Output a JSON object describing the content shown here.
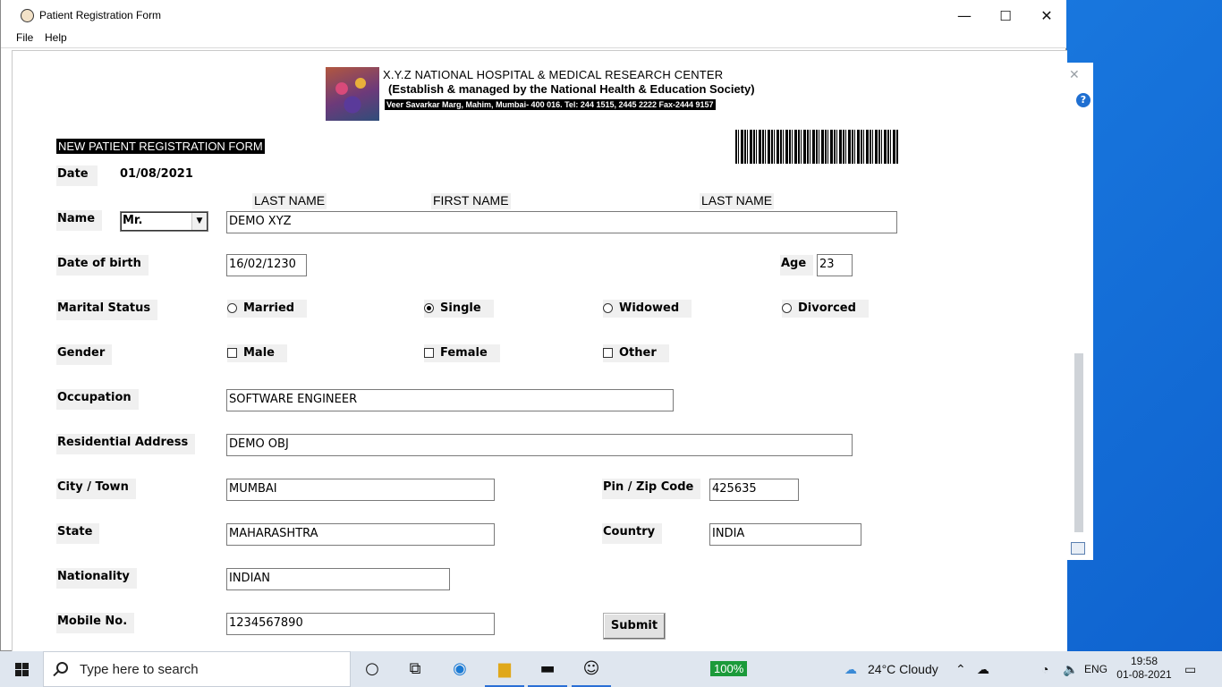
{
  "window": {
    "title": "Patient Registration Form",
    "controls": {
      "minimize": "—",
      "maximize": "☐",
      "close": "✕"
    }
  },
  "menu": [
    "File",
    "Help"
  ],
  "header": {
    "line1": "X.Y.Z NATIONAL HOSPITAL & MEDICAL RESEARCH CENTER",
    "line2": "(Establish & managed by the National Health & Education Society)",
    "line3": "Veer Savarkar Marg, Mahim, Mumbai- 400 016.  Tel: 244 1515, 2445 2222 Fax-2444 9157"
  },
  "form": {
    "title": "NEW PATIENT REGISTRATION FORM",
    "date_label": "Date",
    "date_value": "01/08/2021",
    "name_columns": [
      "LAST NAME",
      "FIRST NAME",
      "LAST NAME"
    ],
    "name_label": "Name",
    "salutation": "Mr.",
    "name_value": "DEMO XYZ",
    "dob_label": "Date of birth",
    "dob_value": "16/02/1230",
    "age_label": "Age",
    "age_value": "23",
    "marital_label": "Marital Status",
    "marital_options": [
      {
        "label": "Married",
        "selected": false
      },
      {
        "label": "Single",
        "selected": true
      },
      {
        "label": "Widowed",
        "selected": false
      },
      {
        "label": "Divorced",
        "selected": false
      }
    ],
    "gender_label": "Gender",
    "gender_options": [
      {
        "label": "Male",
        "checked": false
      },
      {
        "label": "Female",
        "checked": false
      },
      {
        "label": "Other",
        "checked": false
      }
    ],
    "occupation_label": "Occupation",
    "occupation_value": "SOFTWARE ENGINEER",
    "address_label": "Residential Address",
    "address_value": "DEMO OBJ",
    "city_label": "City / Town",
    "city_value": "MUMBAI",
    "pin_label": "Pin / Zip Code",
    "pin_value": "425635",
    "state_label": "State",
    "state_value": "MAHARASHTRA",
    "country_label": "Country",
    "country_value": "INDIA",
    "nationality_label": "Nationality",
    "nationality_value": "INDIAN",
    "mobile_label": "Mobile No.",
    "mobile_value": "1234567890",
    "submit_label": "Submit"
  },
  "taskbar": {
    "search_placeholder": "Type here to search",
    "battery": "100%",
    "weather": "24°C  Cloudy",
    "language": "ENG",
    "time": "19:58",
    "date": "01-08-2021"
  }
}
